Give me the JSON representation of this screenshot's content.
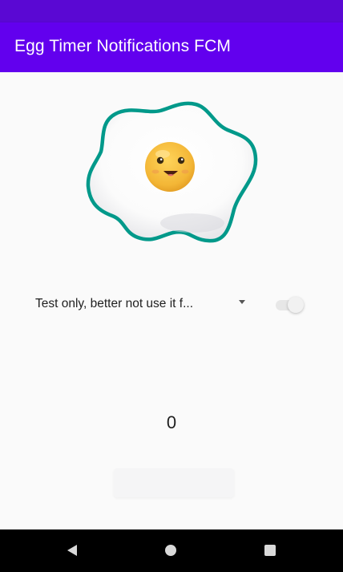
{
  "app_bar": {
    "title": "Egg Timer Notifications FCM",
    "background": "#6200ee",
    "status_background": "#5a08d3"
  },
  "egg": {
    "icon": "fried-egg-icon",
    "outline_color": "#00998a",
    "yolk_color": "#f6bd3c"
  },
  "timer_options": {
    "selected_value": "Test only, better not use it f..."
  },
  "switch": {
    "on": true
  },
  "timer": {
    "value": "0"
  },
  "start_button": {
    "label": ""
  },
  "system_nav": {
    "back_icon": "back-icon",
    "home_icon": "home-icon",
    "recents_icon": "recents-icon"
  }
}
